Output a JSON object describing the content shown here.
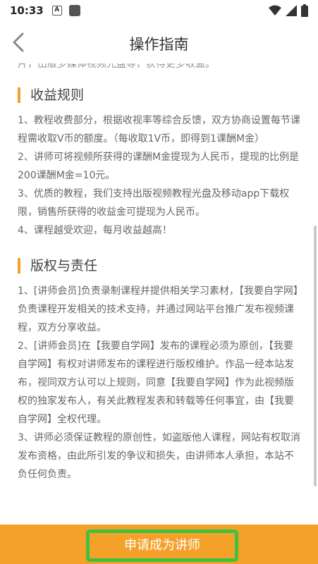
{
  "status_bar": {
    "time": "10:33",
    "notification_letter": "A"
  },
  "header": {
    "title": "操作指南"
  },
  "content": {
    "partial_text": "片，出版多媒体视频光盘等，获得更多收益。",
    "sections": [
      {
        "heading": "收益规则",
        "paragraphs": [
          "1、教程收费部分，根据收视率等综合反馈，双方协商设置每节课程需收取V币的额度。（每收取1V币，即得到1课酬M金）",
          "2、讲师可将视频所获得的课酬M金提现为人民币，提现的比例是200课酬M金=10元。",
          "3、优质的教程，我们支持出版视频教程光盘及移动app下载权限，销售所获得的收益金可提现为人民币。",
          "4、课程越受欢迎，每月收益越高！"
        ]
      },
      {
        "heading": "版权与责任",
        "paragraphs": [
          "1、[讲师会员]负责录制课程并提供相关学习素材，【我要自学网】负责课程开发相关的技术支持，并通过网站平台推广发布视频课程，双方分享收益。",
          "2、[讲师会员]在【我要自学网】发布的课程必须为原创，【我要自学网】有权对讲师发布的课程进行版权维护。作品一经本站发布，视同双方认可以上规则，同意【我要自学网】作为此视频版权的独家发布人，有关此教程发表和转载等任何事宜，由【我要自学网】全权代理。",
          "3、讲师必须保证教程的原创性，如盗版他人课程，网站有权取消发布资格，由此所引发的争议和损失，由讲师本人承担，本站不负任何负责。"
        ]
      }
    ]
  },
  "bottom": {
    "apply_label": "申请成为讲师"
  },
  "colors": {
    "accent": "#f4a12a",
    "highlight_border": "#3fc13f"
  }
}
